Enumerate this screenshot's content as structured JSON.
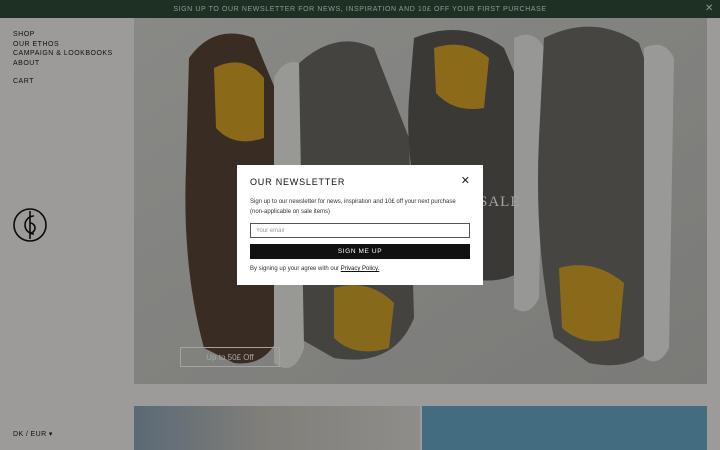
{
  "topbar": {
    "message": "SIGN UP TO OUR NEWSLETTER FOR NEWS, INSPIRATION AND 10£ OFF YOUR FIRST PURCHASE",
    "close_icon": "close-icon"
  },
  "nav": {
    "items": [
      "SHOP",
      "OUR ETHOS",
      "CAMPAIGN & LOOKBOOKS",
      "ABOUT"
    ],
    "cart": "CART"
  },
  "logo": {
    "icon": "brand-monogram-icon"
  },
  "locale": {
    "label": "DK / EUR",
    "caret": "▾"
  },
  "hero": {
    "sale_label": "SALE",
    "cta_label": "Up to 50£ Off"
  },
  "modal": {
    "title": "OUR NEWSLETTER",
    "close_glyph": "✕",
    "description": "Sign up to our newsletter for news, inspiration and 10£ off your next purchase (non-applicable on sale items)",
    "email_placeholder": "Your email",
    "submit_label": "SIGN ME UP",
    "terms_prefix": "By signing up your agree with our ",
    "terms_link": "Privacy Policy."
  },
  "colors": {
    "topbar_bg": "#2f4a38",
    "button_bg": "#111111",
    "sidebar_bg": "#f4f3f1"
  }
}
